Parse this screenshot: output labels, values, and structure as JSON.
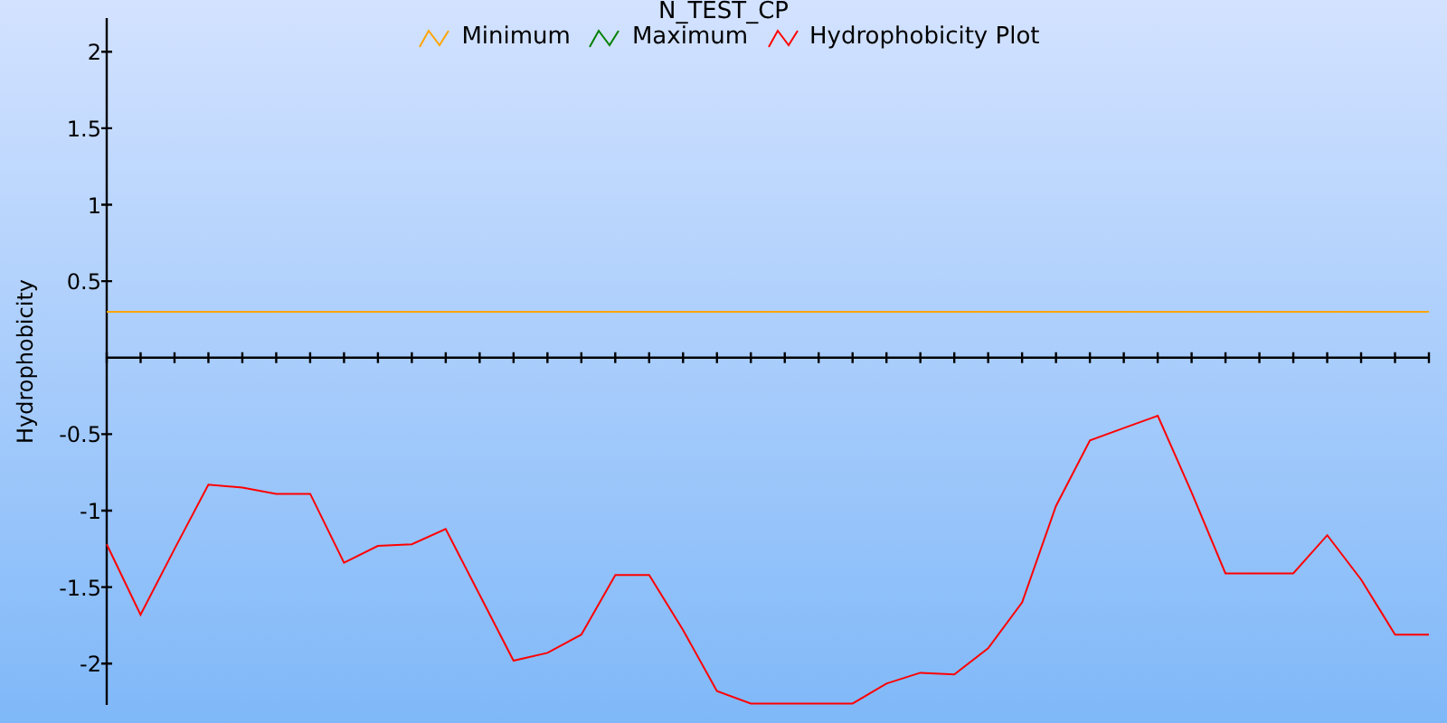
{
  "chart": {
    "chart_data": {
      "type": "line",
      "title": "N_TEST_CP",
      "legend": "top",
      "ylabel": "Hydrophobicity",
      "categories": [
        null,
        null,
        null,
        null,
        null,
        null,
        null,
        null,
        null,
        null,
        null,
        null,
        null,
        null,
        null,
        null,
        null,
        null,
        null,
        null,
        null,
        null,
        null,
        null,
        null,
        null,
        null,
        null,
        null,
        null,
        null,
        null,
        null,
        null,
        null,
        null,
        null,
        null,
        null,
        null
      ],
      "ylim": [
        -2.27,
        2.22
      ],
      "yticks": [
        {
          "value": -2,
          "label": "-2"
        },
        {
          "value": -1.5,
          "label": "-1.5"
        },
        {
          "value": -1,
          "label": "-1"
        },
        {
          "value": -0.5,
          "label": "-0.5"
        },
        {
          "value": 0.5,
          "label": "0.5"
        },
        {
          "value": 1,
          "label": "1"
        },
        {
          "value": 1.5,
          "label": "1.5"
        },
        {
          "value": 2,
          "label": "2"
        }
      ],
      "series": [
        {
          "name": "Minimum",
          "color": "#ffa500",
          "values": [
            0.3,
            0.3,
            0.3,
            0.3,
            0.3,
            0.3,
            0.3,
            0.3,
            0.3,
            0.3,
            0.3,
            0.3,
            0.3,
            0.3,
            0.3,
            0.3,
            0.3,
            0.3,
            0.3,
            0.3,
            0.3,
            0.3,
            0.3,
            0.3,
            0.3,
            0.3,
            0.3,
            0.3,
            0.3,
            0.3,
            0.3,
            0.3,
            0.3,
            0.3,
            0.3,
            0.3,
            0.3,
            0.3,
            0.3,
            0.3
          ]
        },
        {
          "name": "Maximum",
          "color": "#008000",
          "values": [
            null,
            null,
            null,
            null,
            null,
            null,
            null,
            null,
            null,
            null,
            null,
            null,
            null,
            null,
            null,
            null,
            null,
            null,
            null,
            null,
            null,
            null,
            null,
            null,
            null,
            null,
            null,
            null,
            null,
            null,
            null,
            null,
            null,
            null,
            null,
            null,
            null,
            null,
            null,
            null
          ]
        },
        {
          "name": "Hydrophobicity Plot",
          "color": "#ff0000",
          "values": [
            -1.22,
            -1.68,
            -1.25,
            -0.83,
            -0.85,
            -0.89,
            -0.89,
            -1.34,
            -1.23,
            -1.22,
            -1.12,
            -1.55,
            -1.98,
            -1.93,
            -1.81,
            -1.42,
            -1.42,
            -1.78,
            -2.18,
            -2.26,
            -2.26,
            -2.26,
            -2.26,
            -2.13,
            -2.06,
            -2.07,
            -1.9,
            -1.6,
            -0.97,
            -0.54,
            -0.46,
            -0.38,
            -0.88,
            -1.41,
            -1.41,
            -1.41,
            -1.16,
            -1.45,
            -1.81,
            -1.81
          ]
        }
      ]
    }
  }
}
